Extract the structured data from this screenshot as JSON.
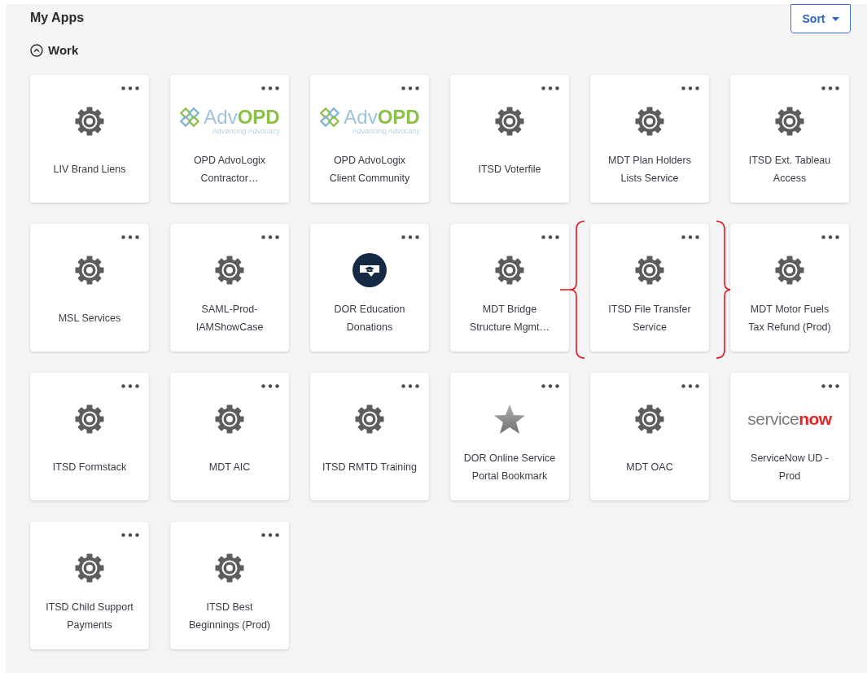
{
  "header": {
    "title": "My Apps",
    "sort_button": "Sort"
  },
  "section": {
    "title": "Work",
    "expanded": true
  },
  "apps": [
    {
      "name": "LIV Brand Liens",
      "logo": {
        "kind": "gear"
      },
      "highlighted": false
    },
    {
      "name": "OPD AdvoLogix Contractor…",
      "logo": {
        "kind": "advopd",
        "wordmark": [
          "Adv",
          "OPD"
        ],
        "tagline": "Advancing Advocacy"
      },
      "highlighted": false
    },
    {
      "name": "OPD AdvoLogix Client Community",
      "logo": {
        "kind": "advopd",
        "wordmark": [
          "Adv",
          "OPD"
        ],
        "tagline": "Advancing Advocacy"
      },
      "highlighted": false
    },
    {
      "name": "ITSD Voterfile",
      "logo": {
        "kind": "gear"
      },
      "highlighted": false
    },
    {
      "name": "MDT Plan Holders Lists Service",
      "logo": {
        "kind": "gear"
      },
      "highlighted": false
    },
    {
      "name": "ITSD Ext. Tableau Access",
      "logo": {
        "kind": "gear"
      },
      "highlighted": false
    },
    {
      "name": "MSL Services",
      "logo": {
        "kind": "gear"
      },
      "highlighted": false
    },
    {
      "name": "SAML-Prod-IAMShowCase",
      "logo": {
        "kind": "gear"
      },
      "highlighted": false
    },
    {
      "name": "DOR Education Donations",
      "logo": {
        "kind": "dor"
      },
      "highlighted": false
    },
    {
      "name": "MDT Bridge Structure Mgmt…",
      "logo": {
        "kind": "gear"
      },
      "highlighted": false
    },
    {
      "name": "ITSD File Transfer Service",
      "logo": {
        "kind": "gear"
      },
      "highlighted": true
    },
    {
      "name": "MDT Motor Fuels Tax Refund (Prod)",
      "logo": {
        "kind": "gear"
      },
      "highlighted": false
    },
    {
      "name": "ITSD Formstack",
      "logo": {
        "kind": "gear"
      },
      "highlighted": false
    },
    {
      "name": "MDT AIC",
      "logo": {
        "kind": "gear"
      },
      "highlighted": false
    },
    {
      "name": "ITSD RMTD Training",
      "logo": {
        "kind": "gear"
      },
      "highlighted": false
    },
    {
      "name": "DOR Online Service Portal Bookmark",
      "logo": {
        "kind": "star"
      },
      "highlighted": false
    },
    {
      "name": "MDT OAC",
      "logo": {
        "kind": "gear"
      },
      "highlighted": false
    },
    {
      "name": "ServiceNow UD - Prod",
      "logo": {
        "kind": "servicenow",
        "wordmark": [
          "service",
          "now"
        ]
      },
      "highlighted": false
    },
    {
      "name": "ITSD Child Support Payments",
      "logo": {
        "kind": "gear"
      },
      "highlighted": false
    },
    {
      "name": "ITSD Best Beginnings (Prod)",
      "logo": {
        "kind": "gear"
      },
      "highlighted": false
    }
  ]
}
